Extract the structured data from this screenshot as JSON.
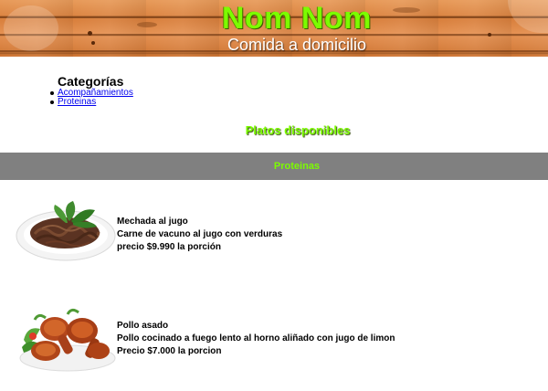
{
  "header": {
    "title": "Nom Nom",
    "subtitle": "Comida a domicilio"
  },
  "categories": {
    "title": "Categorías",
    "items": [
      {
        "label": "Acompañamientos"
      },
      {
        "label": "Proteinas"
      }
    ]
  },
  "dishes_title": "Platos disponibles",
  "section": {
    "label": "Proteinas"
  },
  "dishes": [
    {
      "name": "Mechada al jugo",
      "description": "Carne de vacuno al jugo con verduras",
      "price": "precio $9.990 la porción",
      "image": "shredded-beef-plate-image"
    },
    {
      "name": "Pollo asado",
      "description": "Pollo cocinado a fuego lento al horno aliñado con jugo de limon",
      "price": "Precio $7.000 la porcion",
      "image": "roast-chicken-plate-image"
    }
  ],
  "colors": {
    "title_green": "#7CFC00",
    "section_bar": "#808080",
    "link": "#0000ee"
  }
}
